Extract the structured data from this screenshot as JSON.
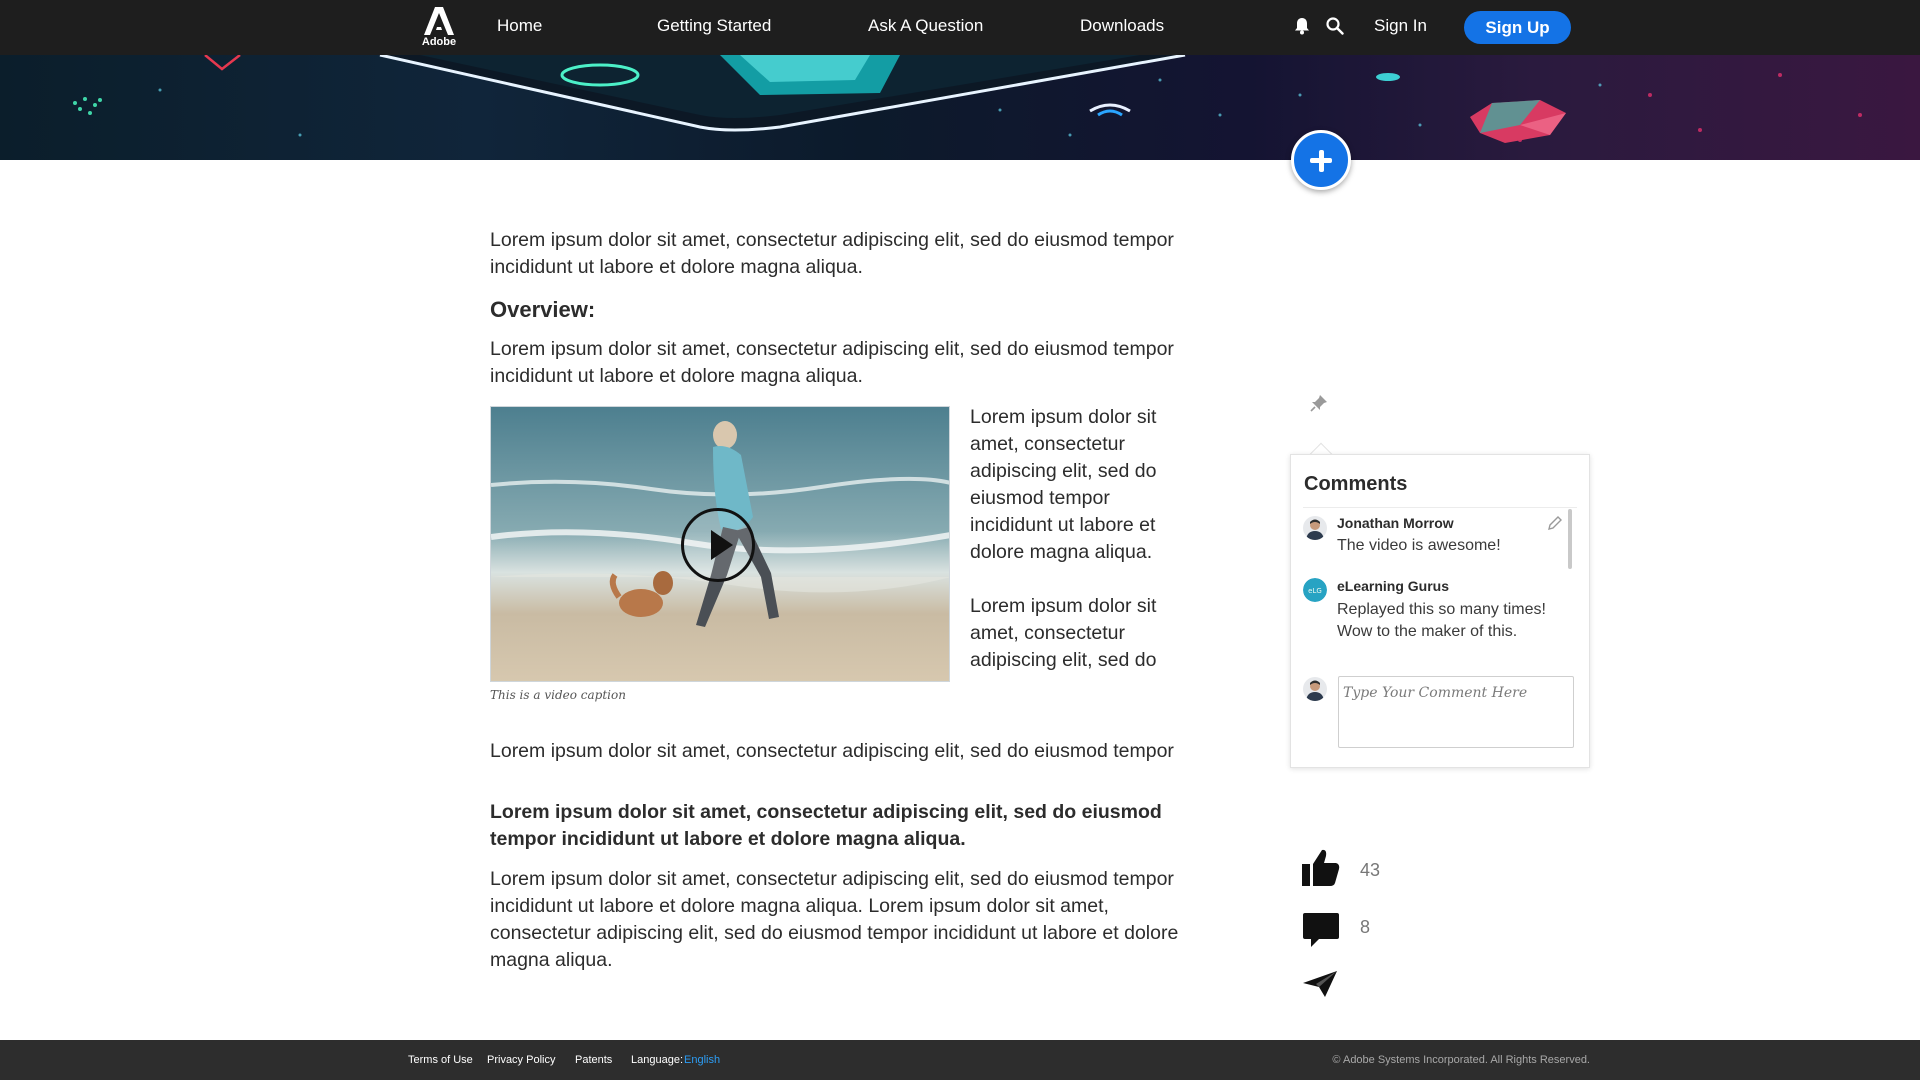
{
  "nav": {
    "logo_text": "Adobe",
    "links": [
      "Home",
      "Getting Started",
      "Ask A Question",
      "Downloads"
    ],
    "notification_icon": "bell-icon",
    "search_icon": "search-icon",
    "sign_in": "Sign In",
    "sign_up": "Sign Up",
    "accent_color": "#1473e6"
  },
  "hero": {
    "add_icon": "plus-icon"
  },
  "article": {
    "intro": "Lorem ipsum dolor sit amet, consectetur adipiscing elit, sed do eiusmod tempor incididunt ut labore et dolore magna aliqua.",
    "overview_heading": "Overview:",
    "overview_text": "Lorem ipsum dolor sit amet, consectetur adipiscing elit, sed do eiusmod tempor incididunt ut labore et dolore magna aliqua.",
    "video_caption": "This is a video caption",
    "side_text_1": "Lorem ipsum dolor sit amet, consectetur adipiscing elit, sed do eiusmod tempor incididunt ut labore et dolore magna aliqua.",
    "side_text_2": "Lorem ipsum dolor sit amet, consectetur adipiscing elit, sed do",
    "single_line": "Lorem ipsum dolor sit amet, consectetur adipiscing elit, sed do eiusmod tempor",
    "bold_para": "Lorem ipsum dolor sit amet, consectetur adipiscing elit, sed do eiusmod tempor incididunt ut labore et dolore magna aliqua.",
    "final_para": "Lorem ipsum dolor sit amet, consectetur adipiscing elit, sed do eiusmod tempor incididunt ut labore et dolore magna aliqua. Lorem ipsum dolor sit amet, consectetur adipiscing elit, sed do eiusmod tempor incididunt ut labore et dolore magna aliqua."
  },
  "comments": {
    "title": "Comments",
    "items": [
      {
        "author": "Jonathan Morrow",
        "text": "The video is awesome!"
      },
      {
        "author": "eLearning Gurus",
        "text": "Replayed this so many times! Wow to the maker of this."
      }
    ],
    "input_placeholder": "Type Your Comment Here",
    "pin_icon": "pin-icon",
    "edit_icon": "pencil-icon"
  },
  "actions": {
    "likes": "43",
    "comment_count": "8",
    "like_icon": "thumbs-up-icon",
    "comment_icon": "comment-icon",
    "share_icon": "paper-plane-icon"
  },
  "footer": {
    "links": [
      "Terms of Use",
      "Privacy Policy",
      "Patents"
    ],
    "language_label": "Language:",
    "language_value": "English",
    "copyright": "© Adobe Systems Incorporated. All Rights Reserved."
  }
}
